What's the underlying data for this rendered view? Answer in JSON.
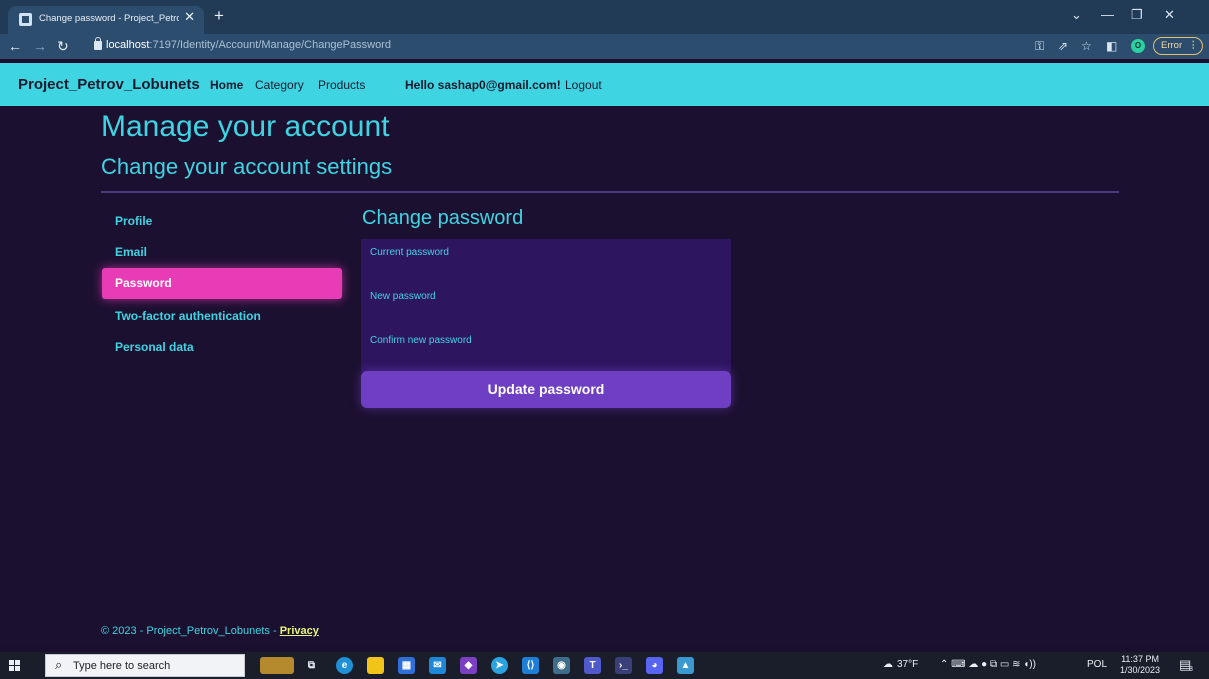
{
  "browser": {
    "tab_title": "Change password - Project_Petrov_Lobunets",
    "new_tab": "+",
    "url_host": "localhost",
    "url_path": ":7197/Identity/Account/Manage/ChangePassword",
    "error_label": "Error"
  },
  "navbar": {
    "brand": "Project_Petrov_Lobunets",
    "links": [
      "Home",
      "Category",
      "Products"
    ],
    "greeting": "Hello sashap0@gmail.com!",
    "logout": "Logout"
  },
  "page": {
    "title": "Manage your account",
    "subtitle": "Change your account settings"
  },
  "sidebar": {
    "items": [
      {
        "label": "Profile"
      },
      {
        "label": "Email"
      },
      {
        "label": "Password"
      },
      {
        "label": "Two-factor authentication"
      },
      {
        "label": "Personal data"
      }
    ],
    "active": "Password"
  },
  "form": {
    "heading": "Change password",
    "fields": [
      "Current password",
      "New password",
      "Confirm new password"
    ],
    "submit": "Update password"
  },
  "footer": {
    "text": "© 2023 - Project_Petrov_Lobunets - ",
    "privacy": "Privacy"
  },
  "taskbar": {
    "search_placeholder": "Type here to search",
    "weather": "37°F",
    "language": "POL",
    "time": "11:37 PM",
    "date": "1/30/2023",
    "notifications": "8"
  },
  "colors": {
    "accent": "#3fd4e2",
    "active_item": "#e83bb6",
    "button": "#6e3fc2",
    "background": "#1c1031"
  }
}
